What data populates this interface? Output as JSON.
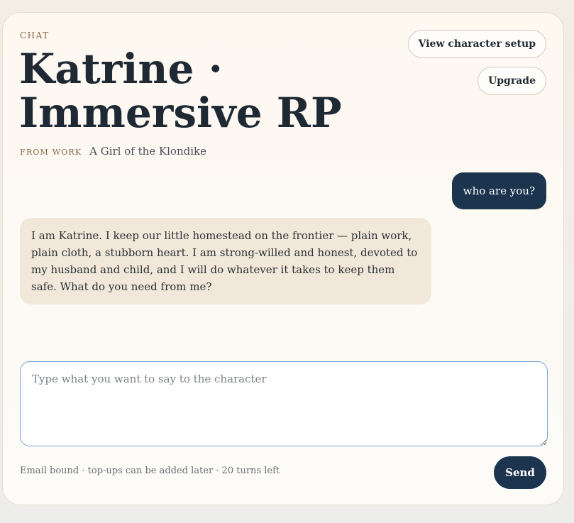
{
  "header": {
    "eyebrow": "CHAT",
    "title": "Katrine · Immersive RP",
    "work_label": "FROM WORK",
    "work_name": "A Girl of the Klondike"
  },
  "actions": {
    "view_setup_label": "View character setup",
    "upgrade_label": "Upgrade"
  },
  "messages": [
    {
      "role": "user",
      "text": "who are you?"
    },
    {
      "role": "character",
      "text": "I am Katrine. I keep our little homestead on the frontier — plain work, plain cloth, a stubborn heart. I am strong-willed and honest, devoted to my husband and child, and I will do whatever it takes to keep them safe. What do you need from me?"
    }
  ],
  "composer": {
    "placeholder": "Type what you want to say to the character",
    "value": "",
    "status": "Email bound · top-ups can be added later · 20 turns left",
    "send_label": "Send"
  },
  "colors": {
    "accent_navy": "#1c344e",
    "eyebrow_brown": "#8a6a45",
    "bot_bubble": "#f1e8da",
    "input_border": "#7aa6d8"
  }
}
